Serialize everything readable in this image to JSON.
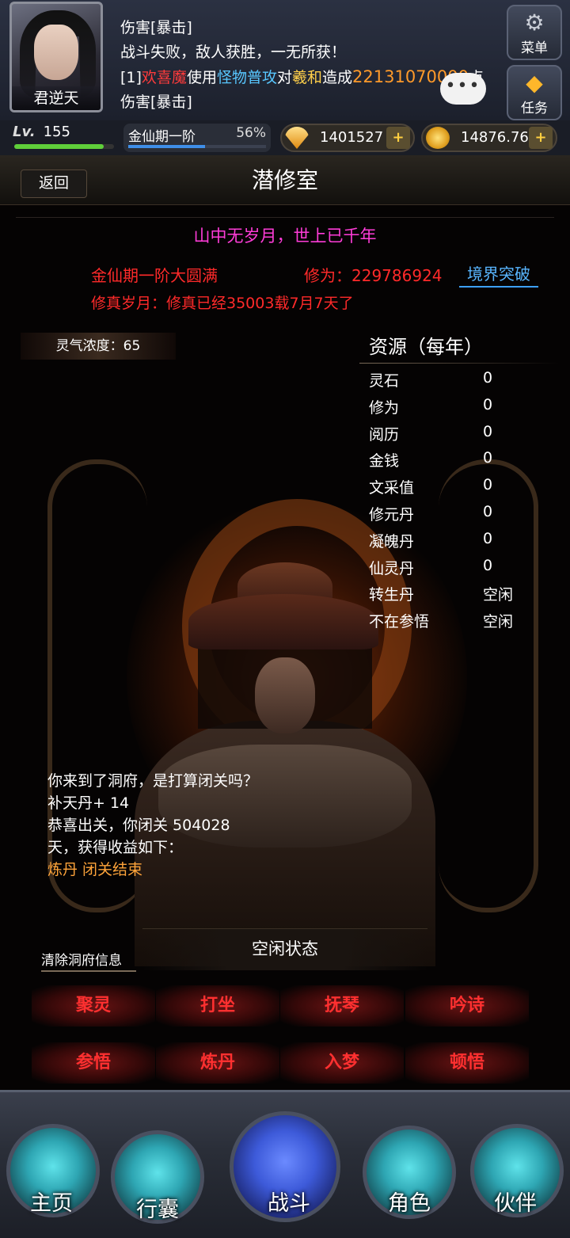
{
  "player": {
    "name": "君逆天",
    "level_label": "Lv.",
    "level": "155",
    "level_progress": 0.9
  },
  "chat": {
    "line1": "伤害[暴击]",
    "line2": "战斗失败，敌人获胜，一无所获！",
    "line3_prefix": "[1]",
    "line3_attacker": "欢喜魔",
    "line3_use": "使用",
    "line3_skill": "怪物普攻",
    "line3_to": "对",
    "line3_target": "羲和",
    "line3_cause": "造成",
    "line3_damage": "22131070000",
    "line3_suffix": "点",
    "line4": "伤害[暴击]",
    "bubble": "•••"
  },
  "side_buttons": {
    "menu": "菜单",
    "task": "任务"
  },
  "status": {
    "realm": "金仙期一阶",
    "realm_percent": "56%",
    "realm_progress": 0.56,
    "gems": "1401527",
    "gold": "14876.76",
    "add": "+"
  },
  "title": {
    "back": "返回",
    "page": "潜修室"
  },
  "info": {
    "slogan": "山中无岁月，世上已千年",
    "realm_full": "金仙期一阶大圆满",
    "xiuwei": "修为：229786924",
    "breakthrough": "境界突破",
    "years": "修真岁月：修真已经35003载7月7天了",
    "lingqi": "灵气浓度：65"
  },
  "resources": {
    "title": "资源（每年）",
    "rows": [
      {
        "k": "灵石",
        "v": "0"
      },
      {
        "k": "修为",
        "v": "0"
      },
      {
        "k": "阅历",
        "v": "0"
      },
      {
        "k": "金钱",
        "v": "0"
      },
      {
        "k": "文采值",
        "v": "0"
      },
      {
        "k": "修元丹",
        "v": "0"
      },
      {
        "k": "凝魄丹",
        "v": "0"
      },
      {
        "k": "仙灵丹",
        "v": "0"
      },
      {
        "k": "转生丹",
        "v": "空闲"
      },
      {
        "k": "不在参悟",
        "v": "空闲"
      }
    ]
  },
  "log": {
    "l1": "你来到了洞府，是打算闭关吗？",
    "l2": "补天丹+ 14",
    "l3": "恭喜出关，你闭关 504028",
    "l4": "天，获得收益如下：",
    "l5": "炼丹 闭关结束"
  },
  "idle_status": "空闲状态",
  "clear_info": "清除洞府信息",
  "actions": [
    "聚灵",
    "打坐",
    "抚琴",
    "吟诗",
    "参悟",
    "炼丹",
    "入梦",
    "顿悟"
  ],
  "nav": [
    "主页",
    "行囊",
    "战斗",
    "角色",
    "伙伴"
  ]
}
